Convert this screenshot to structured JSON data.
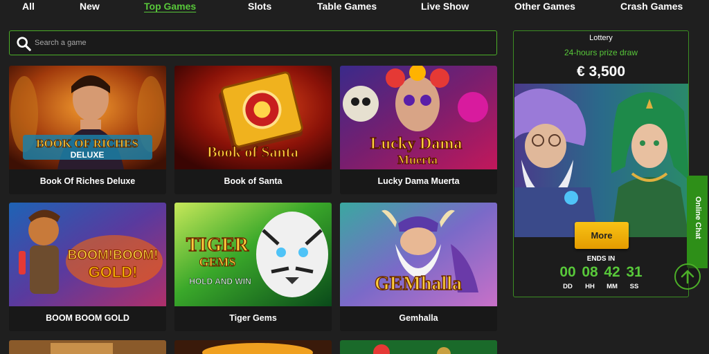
{
  "nav": {
    "items": [
      {
        "label": "All",
        "active": false
      },
      {
        "label": "New",
        "active": false
      },
      {
        "label": "Top Games",
        "active": true
      },
      {
        "label": "Slots",
        "active": false
      },
      {
        "label": "Table Games",
        "active": false
      },
      {
        "label": "Live Show",
        "active": false
      },
      {
        "label": "Other Games",
        "active": false
      },
      {
        "label": "Crash Games",
        "active": false
      }
    ]
  },
  "search": {
    "placeholder": "Search a game",
    "value": ""
  },
  "games": [
    {
      "title": "Book Of Riches Deluxe",
      "art_text": "BOOK OF RICHES",
      "art_sub": "DELUXE"
    },
    {
      "title": "Book of Santa",
      "art_text": "Book of Santa",
      "art_sub": ""
    },
    {
      "title": "Lucky Dama Muerta",
      "art_text": "Lucky Dama",
      "art_sub": "Muerta"
    },
    {
      "title": "BOOM BOOM GOLD",
      "art_text": "BOOM!BOOM!",
      "art_sub": "GOLD!"
    },
    {
      "title": "Tiger Gems",
      "art_text": "TIGER",
      "art_sub": "GEMS",
      "art_extra": "HOLD AND WIN"
    },
    {
      "title": "Gemhalla",
      "art_text": "GEMhalla",
      "art_sub": ""
    }
  ],
  "lottery": {
    "title": "Lottery",
    "subtitle": "24-hours prize draw",
    "prize": "€ 3,500",
    "more_label": "More",
    "ends_in_label": "ENDS IN",
    "timer": [
      {
        "value": "00",
        "unit": "DD"
      },
      {
        "value": "08",
        "unit": "HH"
      },
      {
        "value": "42",
        "unit": "MM"
      },
      {
        "value": "31",
        "unit": "SS"
      }
    ]
  },
  "chat": {
    "label": "Online Chat"
  },
  "icons": {
    "search": "search-icon",
    "scroll_top": "arrow-up-icon"
  },
  "colors": {
    "accent": "#58c83a",
    "background": "#1f1f1f",
    "button": "#f0b000"
  }
}
